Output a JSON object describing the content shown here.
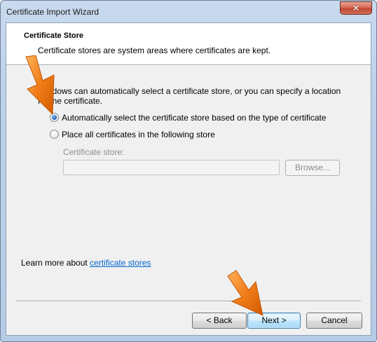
{
  "window": {
    "title": "Certificate Import Wizard",
    "close_label": "✕"
  },
  "header": {
    "title": "Certificate Store",
    "subtitle": "Certificate stores are system areas where certificates are kept."
  },
  "body": {
    "description": "Windows can automatically select a certificate store, or you can specify a location for the certificate.",
    "options": [
      {
        "label": "Automatically select the certificate store based on the type of certificate",
        "checked": true
      },
      {
        "label": "Place all certificates in the following store",
        "checked": false
      }
    ],
    "store_field": {
      "label": "Certificate store:",
      "value": ""
    },
    "browse_label": "Browse..."
  },
  "learn_more": {
    "prefix": "Learn more about ",
    "link_text": "certificate stores"
  },
  "footer": {
    "back_label": "< Back",
    "next_label": "Next >",
    "cancel_label": "Cancel"
  },
  "colors": {
    "link": "#0066cc",
    "arrow": "#f07d18",
    "default_button_border": "#3c7fb1"
  }
}
